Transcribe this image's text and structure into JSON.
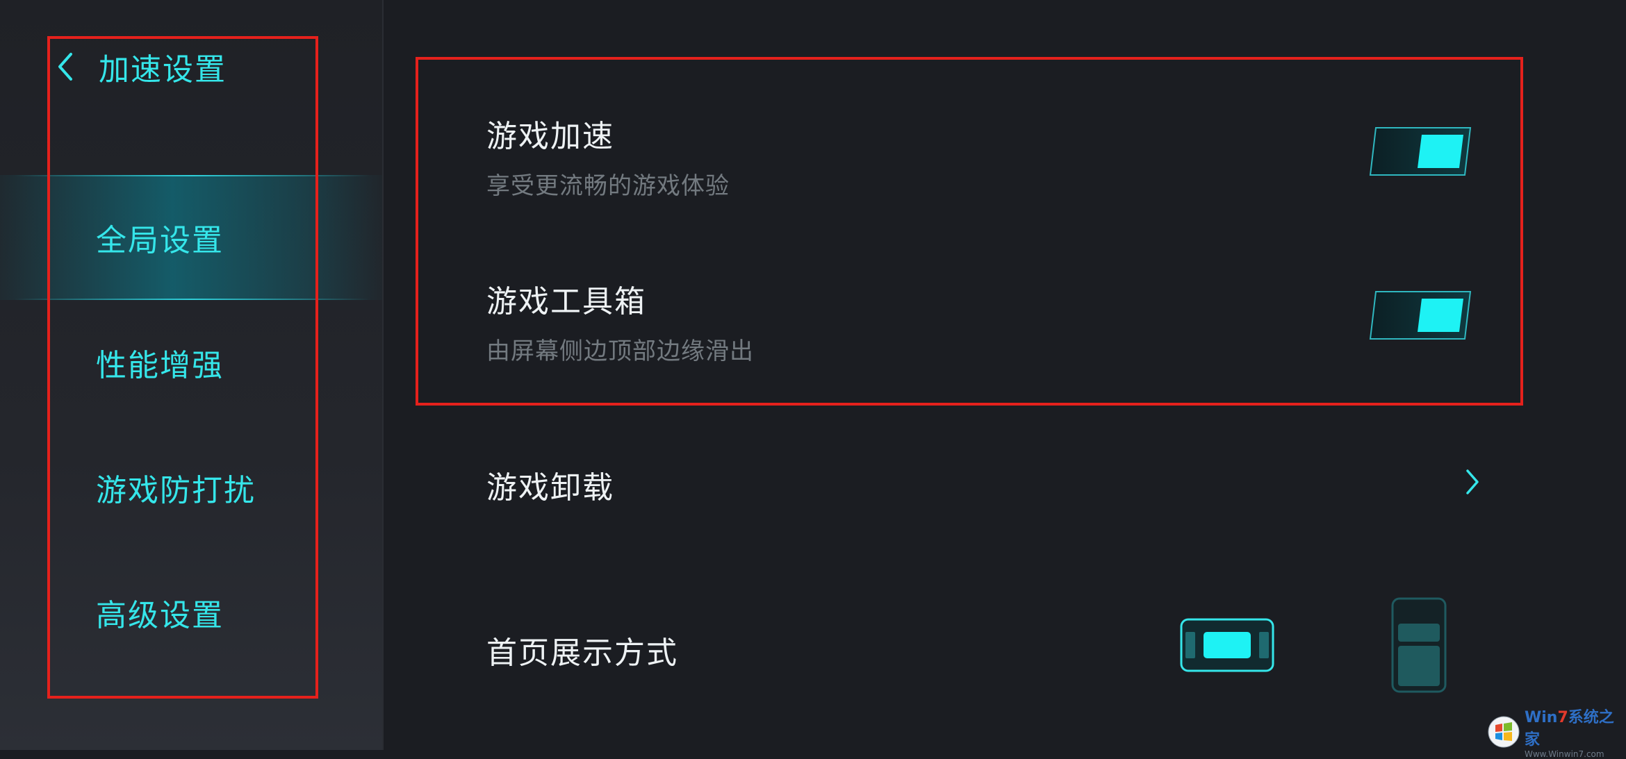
{
  "sidebar": {
    "title": "加速设置",
    "items": [
      {
        "label": "全局设置",
        "active": true
      },
      {
        "label": "性能增强",
        "active": false
      },
      {
        "label": "游戏防打扰",
        "active": false
      },
      {
        "label": "高级设置",
        "active": false
      }
    ]
  },
  "main": {
    "game_acceleration": {
      "title": "游戏加速",
      "subtitle": "享受更流畅的游戏体验",
      "enabled": true
    },
    "game_toolbox": {
      "title": "游戏工具箱",
      "subtitle": "由屏幕侧边顶部边缘滑出",
      "enabled": true
    },
    "game_uninstall": {
      "title": "游戏卸载"
    },
    "home_display_mode": {
      "title": "首页展示方式",
      "selected": "landscape"
    }
  },
  "watermark": {
    "brand_prefix": "Win",
    "brand_number": "7",
    "brand_suffix": "系统之家",
    "url": "Www.Winwin7.com"
  },
  "colors": {
    "accent": "#35e6ea",
    "highlight_box": "#e5211c",
    "background": "#1b1d22"
  }
}
